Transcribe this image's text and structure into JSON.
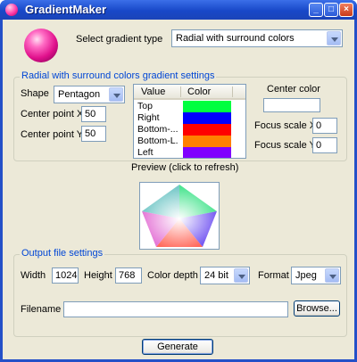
{
  "window": {
    "title": "GradientMaker",
    "minimize": "_",
    "maximize": "□",
    "close": "×"
  },
  "gradient_type": {
    "label": "Select gradient type",
    "value": "Radial with surround colors"
  },
  "settings": {
    "group_title": "Radial with surround colors gradient settings",
    "shape_label": "Shape",
    "shape_value": "Pentagon",
    "center_x_label": "Center point X",
    "center_x_value": "50",
    "center_y_label": "Center point Y",
    "center_y_value": "50",
    "list_headers": {
      "value": "Value",
      "color": "Color"
    },
    "list_rows": [
      {
        "name": "Top",
        "color": "#00ff40"
      },
      {
        "name": "Right",
        "color": "#0000ff"
      },
      {
        "name": "Bottom-...",
        "color": "#ff0000"
      },
      {
        "name": "Bottom-L...",
        "color": "#ff8000"
      },
      {
        "name": "Left",
        "color": "#8000ff"
      }
    ],
    "center_color_label": "Center color",
    "center_color": "#ffffff",
    "focus_x_label": "Focus scale X",
    "focus_x_value": "0",
    "focus_y_label": "Focus scale Y",
    "focus_y_value": "0"
  },
  "preview": {
    "label": "Preview (click to refresh)"
  },
  "output": {
    "group_title": "Output file settings",
    "width_label": "Width",
    "width_value": "1024",
    "height_label": "Height",
    "height_value": "768",
    "depth_label": "Color depth",
    "depth_value": "24 bit",
    "format_label": "Format",
    "format_value": "Jpeg",
    "filename_label": "Filename",
    "filename_value": "",
    "browse_label": "Browse..."
  },
  "generate_label": "Generate",
  "colors": {
    "title_bar": "#1848c8",
    "client_bg": "#ece9d8",
    "group_title": "#0046d5",
    "field_border": "#7f9db9"
  }
}
